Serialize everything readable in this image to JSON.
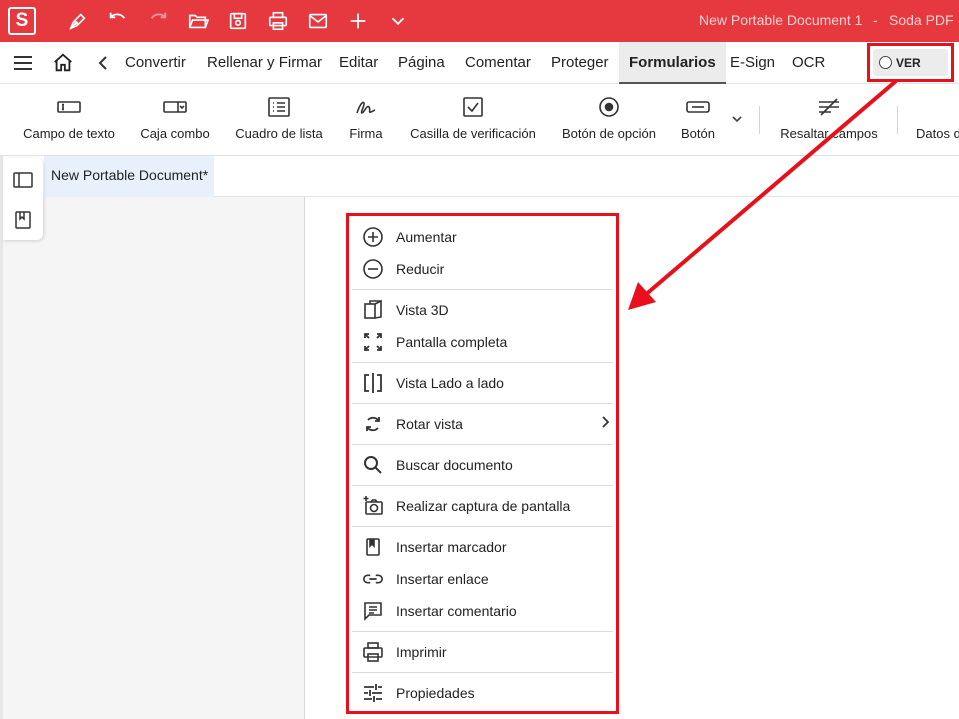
{
  "app": {
    "logo_letter": "S",
    "document_title": "New Portable Document 1",
    "title_separator": "-",
    "app_name": "Soda PDF"
  },
  "quick_access": [
    "pen-icon",
    "undo-icon",
    "redo-icon",
    "open-folder-icon",
    "save-icon",
    "print-icon",
    "mail-icon",
    "plus-icon",
    "chevron-down-icon"
  ],
  "menu": {
    "tabs": [
      "Convertir",
      "Rellenar y Firmar",
      "Editar",
      "Página",
      "Comentar",
      "Proteger",
      "Formularios",
      "E-Sign",
      "OCR"
    ],
    "active_tab": "Formularios",
    "view_toggle": "VER"
  },
  "ribbon": {
    "buttons": [
      "Campo de texto",
      "Caja combo",
      "Cuadro de lista",
      "Firma",
      "Casilla de verificación",
      "Botón de opción",
      "Botón",
      "Resaltar campos",
      "Datos d"
    ]
  },
  "document_tab": "New Portable Document*",
  "context_menu": {
    "items": [
      {
        "label": "Aumentar",
        "icon": "zoom-in-icon"
      },
      {
        "label": "Reducir",
        "icon": "zoom-out-icon"
      },
      {
        "label": "Vista 3D",
        "icon": "view-3d-icon"
      },
      {
        "label": "Pantalla completa",
        "icon": "fullscreen-icon"
      },
      {
        "label": "Vista Lado a lado",
        "icon": "side-by-side-icon"
      },
      {
        "label": "Rotar vista",
        "icon": "rotate-icon"
      },
      {
        "label": "Buscar documento",
        "icon": "search-icon"
      },
      {
        "label": "Realizar captura de pantalla",
        "icon": "screenshot-icon"
      },
      {
        "label": "Insertar marcador",
        "icon": "bookmark-icon"
      },
      {
        "label": "Insertar enlace",
        "icon": "link-icon"
      },
      {
        "label": "Insertar comentario",
        "icon": "comment-icon"
      },
      {
        "label": "Imprimir",
        "icon": "print-icon"
      },
      {
        "label": "Propiedades",
        "icon": "properties-icon"
      }
    ]
  },
  "colors": {
    "brand": "#e5393f",
    "highlight": "#e8101a"
  }
}
